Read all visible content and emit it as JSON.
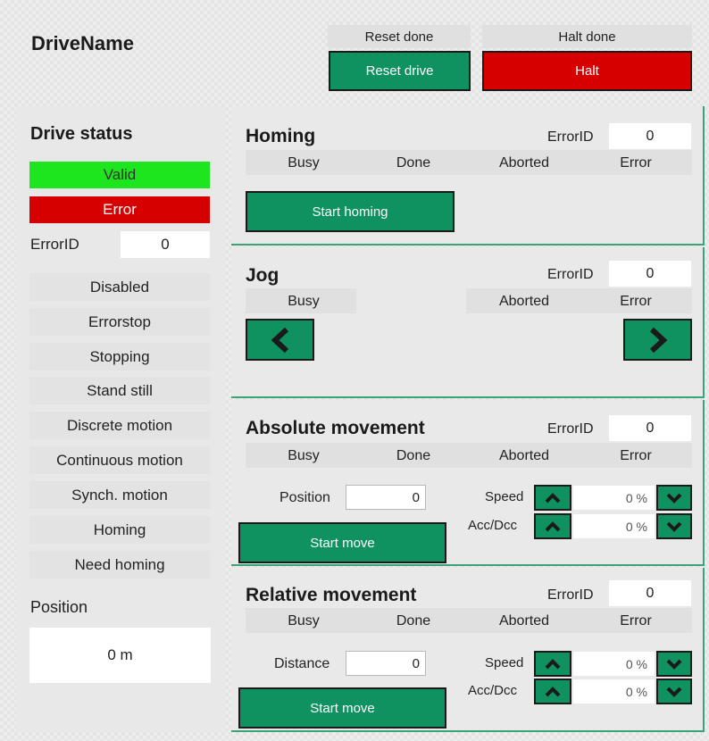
{
  "drive_name": "DriveName",
  "top_controls": {
    "reset_done": "Reset done",
    "reset_drive": "Reset drive",
    "halt_done": "Halt done",
    "halt": "Halt"
  },
  "status": {
    "title": "Drive status",
    "valid": "Valid",
    "error": "Error",
    "error_id_label": "ErrorID",
    "error_id_value": "0",
    "states": [
      "Disabled",
      "Errorstop",
      "Stopping",
      "Stand still",
      "Discrete motion",
      "Continuous motion",
      "Synch. motion",
      "Homing",
      "Need homing"
    ],
    "position_label": "Position",
    "position_value": "0 m"
  },
  "homing": {
    "title": "Homing",
    "error_id_label": "ErrorID",
    "error_id_value": "0",
    "flags": [
      "Busy",
      "Done",
      "Aborted",
      "Error"
    ],
    "button": "Start homing"
  },
  "jog": {
    "title": "Jog",
    "error_id_label": "ErrorID",
    "error_id_value": "0",
    "busy": "Busy",
    "aborted": "Aborted",
    "error": "Error"
  },
  "absolute": {
    "title": "Absolute movement",
    "error_id_label": "ErrorID",
    "error_id_value": "0",
    "flags": [
      "Busy",
      "Done",
      "Aborted",
      "Error"
    ],
    "input_label": "Position",
    "input_value": "0",
    "speed_label": "Speed",
    "speed_value": "0 %",
    "acc_label": "Acc/Dcc",
    "acc_value": "0 %",
    "button": "Start move"
  },
  "relative": {
    "title": "Relative movement",
    "error_id_label": "ErrorID",
    "error_id_value": "0",
    "flags": [
      "Busy",
      "Done",
      "Aborted",
      "Error"
    ],
    "input_label": "Distance",
    "input_value": "0",
    "speed_label": "Speed",
    "speed_value": "0 %",
    "acc_label": "Acc/Dcc",
    "acc_value": "0 %",
    "button": "Start move"
  },
  "colors": {
    "green_button": "#0f9160",
    "red": "#d70000",
    "valid_green": "#1ee61e",
    "panel_border": "#3aa37a"
  },
  "icons": {
    "jog_left": "chevron-left-icon",
    "jog_right": "chevron-right-icon",
    "up": "chevron-up-icon",
    "down": "chevron-down-icon"
  }
}
